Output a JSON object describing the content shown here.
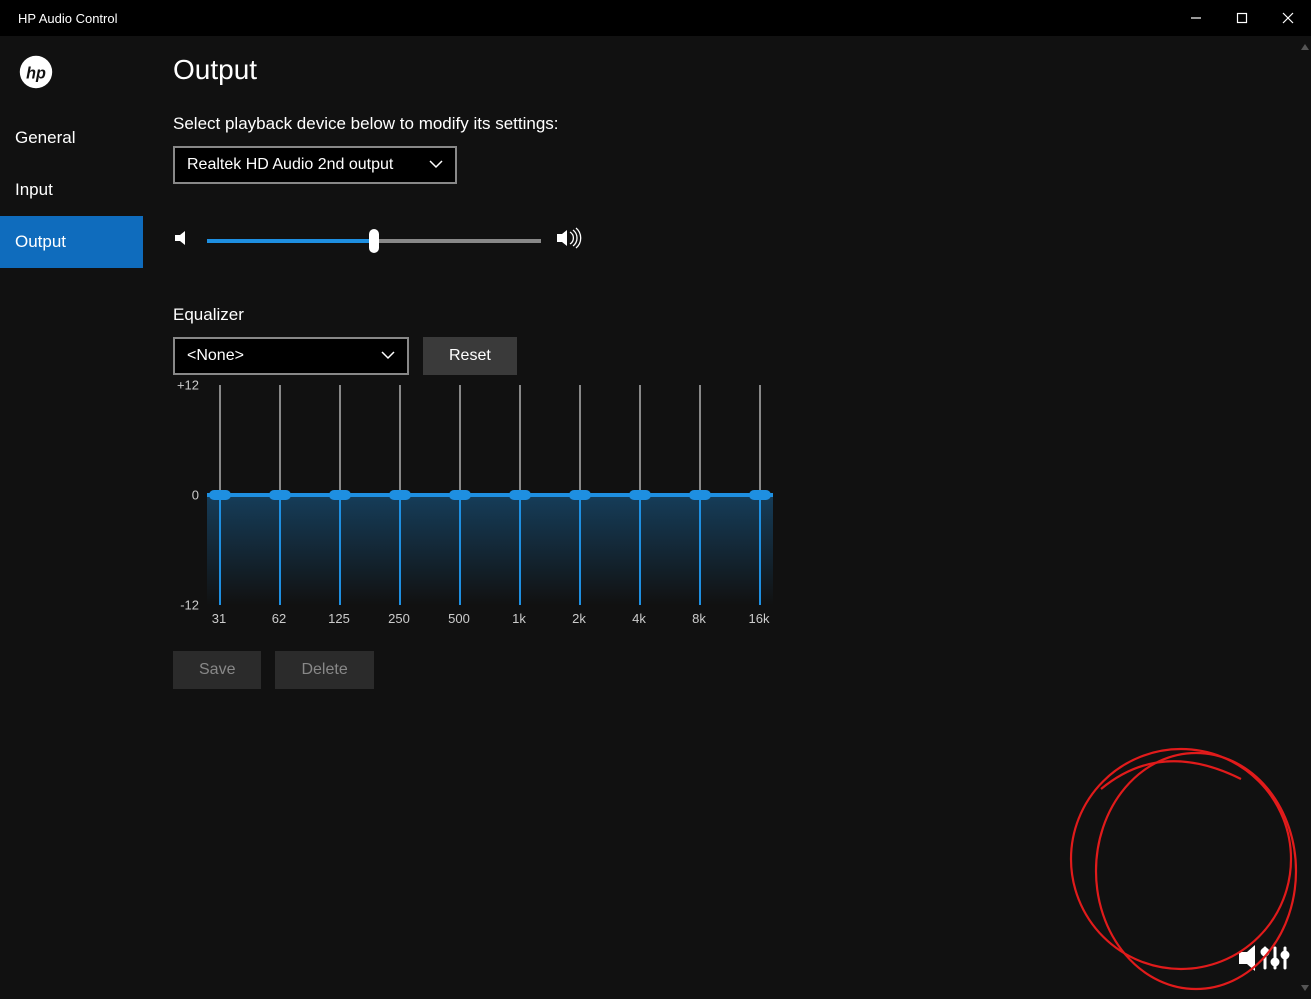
{
  "window": {
    "title": "HP Audio Control"
  },
  "sidebar": {
    "items": [
      {
        "label": "General",
        "active": false
      },
      {
        "label": "Input",
        "active": false
      },
      {
        "label": "Output",
        "active": true
      }
    ]
  },
  "page": {
    "title": "Output",
    "device_prompt": "Select playback device below to modify its settings:",
    "device_selected": "Realtek HD Audio 2nd output",
    "volume_percent": 50
  },
  "equalizer": {
    "label": "Equalizer",
    "preset_selected": "<None>",
    "reset_label": "Reset",
    "save_label": "Save",
    "delete_label": "Delete",
    "tick_top": "+12",
    "tick_mid": "0",
    "tick_bot": "-12",
    "bands": [
      {
        "freq": "31",
        "gain_db": 0
      },
      {
        "freq": "62",
        "gain_db": 0
      },
      {
        "freq": "125",
        "gain_db": 0
      },
      {
        "freq": "250",
        "gain_db": 0
      },
      {
        "freq": "500",
        "gain_db": 0
      },
      {
        "freq": "1k",
        "gain_db": 0
      },
      {
        "freq": "2k",
        "gain_db": 0
      },
      {
        "freq": "4k",
        "gain_db": 0
      },
      {
        "freq": "8k",
        "gain_db": 0
      },
      {
        "freq": "16k",
        "gain_db": 0
      }
    ]
  },
  "colors": {
    "accent": "#1e8fe1",
    "annotation": "#e11b1b"
  }
}
